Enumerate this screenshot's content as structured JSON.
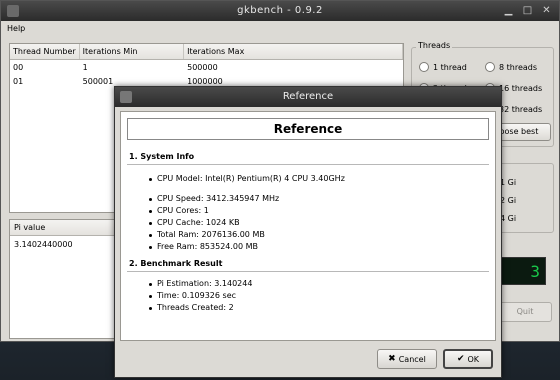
{
  "window": {
    "title": "gkbench - 0.9.2"
  },
  "menu": {
    "help": "Help"
  },
  "table": {
    "headers": [
      "Thread Number",
      "Iterations Min",
      "Iterations Max"
    ],
    "rows": [
      [
        "00",
        "1",
        "500000"
      ],
      [
        "01",
        "500001",
        "1000000"
      ]
    ]
  },
  "pi": {
    "header": "Pi value",
    "value": "3.1402440000"
  },
  "threads": {
    "label": "Threads",
    "options": [
      "1 thread",
      "8 threads",
      "2 threads",
      "16 threads",
      "32 threads"
    ],
    "choose_best": "oose best"
  },
  "side_values": [
    "1 Gi",
    "2 Gi",
    "4 Gi"
  ],
  "lcd_value": "3",
  "quit_label": "Quit",
  "dialog": {
    "title": "Reference",
    "heading": "Reference",
    "section1": "1. System Info",
    "cpu_model": "CPU Model: Intel(R) Pentium(R) 4 CPU 3.40GHz",
    "system_items": [
      "CPU Speed: 3412.345947 MHz",
      "CPU Cores: 1",
      "CPU Cache: 1024 KB",
      "Total Ram: 2076136.00 MB",
      "Free Ram: 853524.00 MB"
    ],
    "section2": "2. Benchmark Result",
    "bench_items": [
      "Pi Estimation: 3.140244",
      "Time: 0.109326 sec",
      "Threads Created: 2"
    ],
    "cancel_label": "Cancel",
    "ok_label": "OK"
  }
}
